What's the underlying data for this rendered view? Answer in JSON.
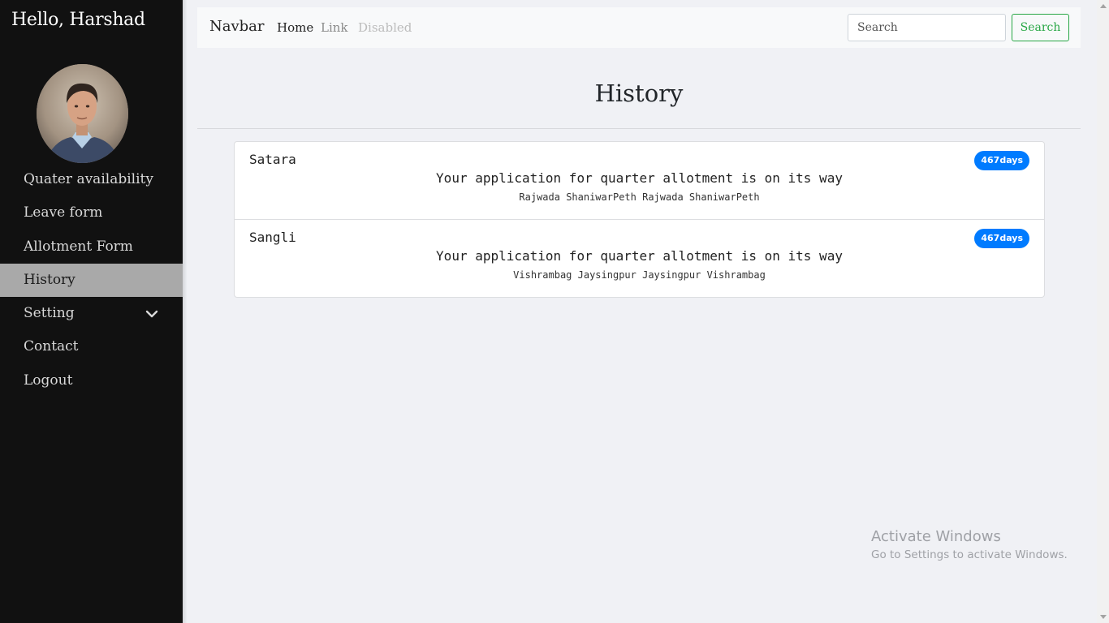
{
  "sidebar": {
    "greeting": "Hello, Harshad",
    "items": [
      {
        "label": "Quater availability"
      },
      {
        "label": "Leave form"
      },
      {
        "label": "Allotment Form"
      },
      {
        "label": "History",
        "active": true
      },
      {
        "label": "Setting",
        "icon": "chevron-down-icon"
      },
      {
        "label": "Contact"
      },
      {
        "label": "Logout"
      }
    ]
  },
  "navbar": {
    "brand": "Navbar",
    "links": [
      "Home",
      "Link",
      "Disabled"
    ],
    "search_placeholder": "Search",
    "search_button": "Search"
  },
  "main": {
    "title": "History",
    "history": [
      {
        "location": "Satara",
        "message": "Your application for quarter allotment is on its way",
        "address": "Rajwada ShaniwarPeth Rajwada ShaniwarPeth",
        "badge": "467days"
      },
      {
        "location": "Sangli",
        "message": "Your application for quarter allotment is on its way",
        "address": "Vishrambag Jaysingpur Jaysingpur Vishrambag",
        "badge": "467days"
      }
    ]
  },
  "watermark": {
    "line1": "Activate Windows",
    "line2": "Go to Settings to activate Windows."
  },
  "colors": {
    "sidebar_bg": "#111111",
    "active_item_bg": "#a9a9a9",
    "badge": "#007bff",
    "search_button": "#28a745"
  }
}
